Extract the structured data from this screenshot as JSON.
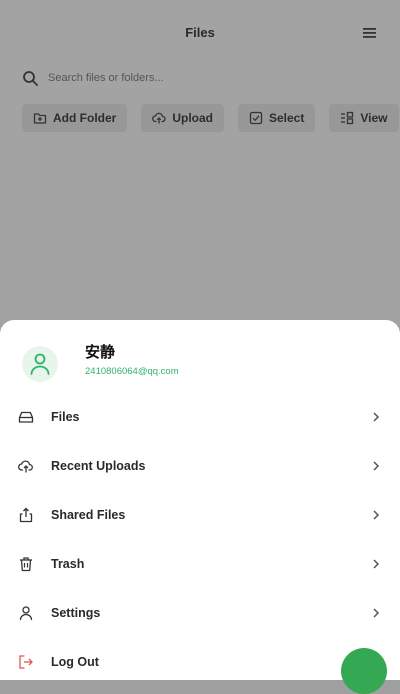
{
  "header": {
    "title": "Files"
  },
  "search": {
    "placeholder": "Search files or folders..."
  },
  "toolbar": {
    "add_folder": "Add Folder",
    "upload": "Upload",
    "select": "Select",
    "view": "View"
  },
  "profile": {
    "name": "安静",
    "email": "2410806064@qq.com"
  },
  "menu": [
    {
      "label": "Files"
    },
    {
      "label": "Recent Uploads"
    },
    {
      "label": "Shared Files"
    },
    {
      "label": "Trash"
    },
    {
      "label": "Settings"
    },
    {
      "label": "Log Out"
    }
  ],
  "colors": {
    "accent": "#2db36a",
    "fab": "#34a853",
    "overlay": "#a3a3a3"
  }
}
